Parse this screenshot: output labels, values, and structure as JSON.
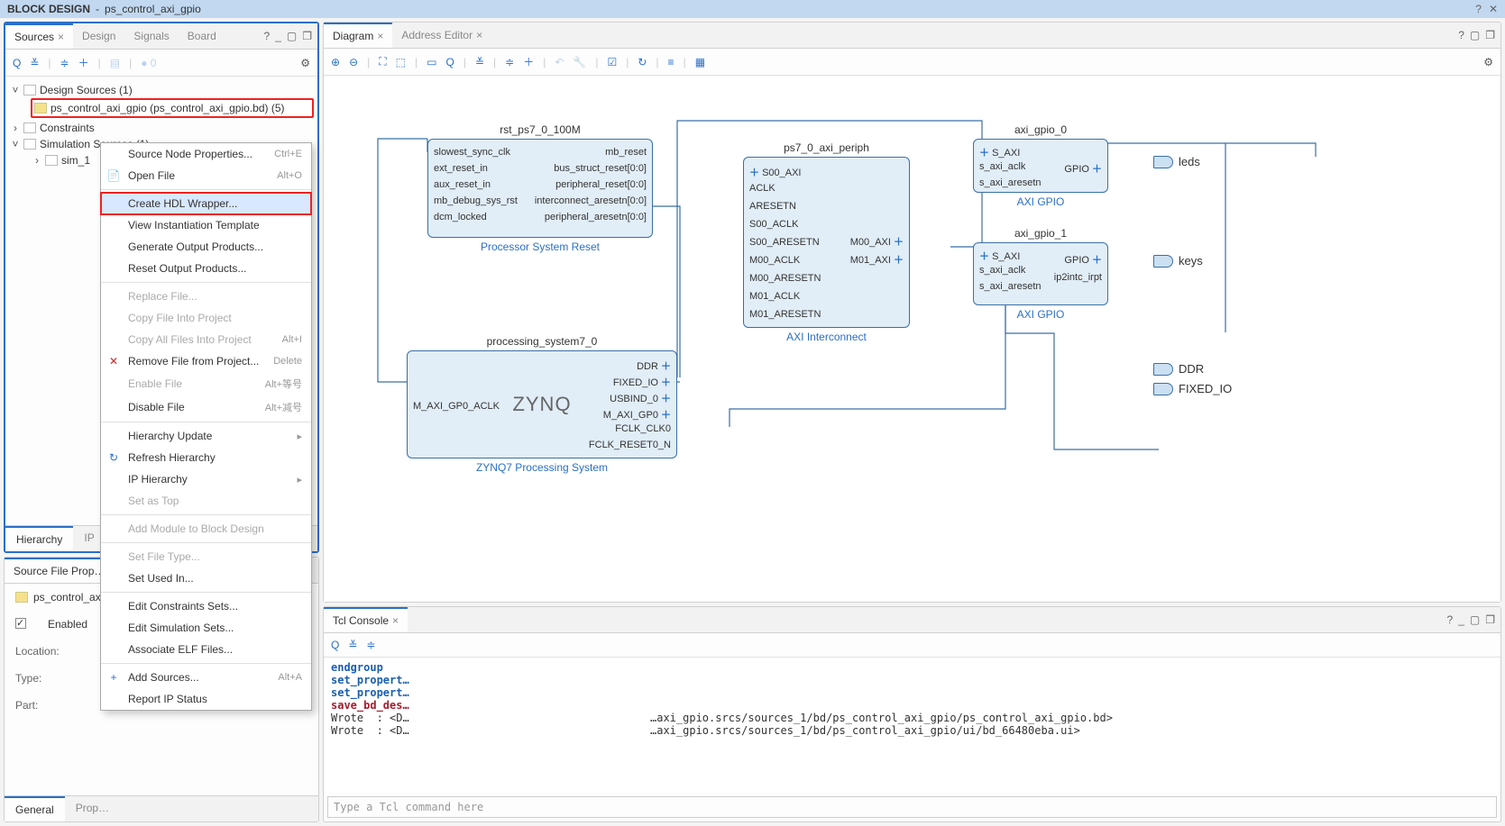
{
  "window": {
    "title_prefix": "BLOCK DESIGN",
    "title_name": "ps_control_axi_gpio"
  },
  "sources_panel": {
    "tabs": [
      "Sources",
      "Design",
      "Signals",
      "Board"
    ],
    "active_tab": 0,
    "tree": {
      "design_sources": "Design Sources (1)",
      "bd_item": "ps_control_axi_gpio (ps_control_axi_gpio.bd) (5)",
      "constraints": "Constraints",
      "simulation": "Simulation Sources (1)",
      "sim1": "sim_1"
    },
    "footer_tabs": [
      "Hierarchy",
      "IP"
    ]
  },
  "props_panel": {
    "title": "Source File Prop…",
    "file": "ps_control_ax…",
    "rows": {
      "enabled": "Enabled",
      "location": "Location:",
      "type": "Type:",
      "part": "Part:"
    },
    "footer_tabs": [
      "General",
      "Prop…"
    ]
  },
  "context_menu": [
    {
      "label": "Source Node Properties...",
      "shortcut": "Ctrl+E",
      "icon": ""
    },
    {
      "label": "Open File",
      "shortcut": "Alt+O",
      "icon": "📄"
    },
    {
      "sep": true
    },
    {
      "label": "Create HDL Wrapper...",
      "highlight": true
    },
    {
      "label": "View Instantiation Template"
    },
    {
      "label": "Generate Output Products..."
    },
    {
      "label": "Reset Output Products..."
    },
    {
      "sep": true
    },
    {
      "label": "Replace File...",
      "disabled": true
    },
    {
      "label": "Copy File Into Project",
      "disabled": true
    },
    {
      "label": "Copy All Files Into Project",
      "shortcut": "Alt+I",
      "disabled": true
    },
    {
      "label": "Remove File from Project...",
      "shortcut": "Delete",
      "icon": "✕",
      "iconRed": true
    },
    {
      "label": "Enable File",
      "shortcut": "Alt+等号",
      "disabled": true
    },
    {
      "label": "Disable File",
      "shortcut": "Alt+减号"
    },
    {
      "sep": true
    },
    {
      "label": "Hierarchy Update",
      "submenu": true
    },
    {
      "label": "Refresh Hierarchy",
      "icon": "↻"
    },
    {
      "label": "IP Hierarchy",
      "submenu": true
    },
    {
      "label": "Set as Top",
      "disabled": true
    },
    {
      "sep": true
    },
    {
      "label": "Add Module to Block Design",
      "disabled": true
    },
    {
      "sep": true
    },
    {
      "label": "Set File Type...",
      "disabled": true
    },
    {
      "label": "Set Used In..."
    },
    {
      "sep": true
    },
    {
      "label": "Edit Constraints Sets..."
    },
    {
      "label": "Edit Simulation Sets..."
    },
    {
      "label": "Associate ELF Files..."
    },
    {
      "sep": true
    },
    {
      "label": "Add Sources...",
      "shortcut": "Alt+A",
      "icon": "+"
    },
    {
      "label": "Report IP Status"
    }
  ],
  "diagram": {
    "tabs": [
      "Diagram",
      "Address Editor"
    ],
    "blocks": {
      "rst": {
        "header": "rst_ps7_0_100M",
        "title": "Processor System Reset",
        "left": [
          "slowest_sync_clk",
          "ext_reset_in",
          "aux_reset_in",
          "mb_debug_sys_rst",
          "dcm_locked"
        ],
        "right": [
          "mb_reset",
          "bus_struct_reset[0:0]",
          "peripheral_reset[0:0]",
          "interconnect_aresetn[0:0]",
          "peripheral_aresetn[0:0]"
        ]
      },
      "zynq": {
        "header": "processing_system7_0",
        "title": "ZYNQ7 Processing System",
        "logo": "ZYNQ",
        "left": [
          "M_AXI_GP0_ACLK"
        ],
        "right": [
          "DDR",
          "FIXED_IO",
          "USBIND_0",
          "M_AXI_GP0",
          "FCLK_CLK0",
          "FCLK_RESET0_N"
        ]
      },
      "interconnect": {
        "header": "ps7_0_axi_periph",
        "title": "AXI Interconnect",
        "left": [
          "S00_AXI",
          "ACLK",
          "ARESETN",
          "S00_ACLK",
          "S00_ARESETN",
          "M00_ACLK",
          "M00_ARESETN",
          "M01_ACLK",
          "M01_ARESETN"
        ],
        "right": [
          "M00_AXI",
          "M01_AXI"
        ]
      },
      "gpio0": {
        "header": "axi_gpio_0",
        "title": "AXI GPIO",
        "left": [
          "S_AXI",
          "s_axi_aclk",
          "s_axi_aresetn"
        ],
        "right": [
          "GPIO"
        ]
      },
      "gpio1": {
        "header": "axi_gpio_1",
        "title": "AXI GPIO",
        "left": [
          "S_AXI",
          "s_axi_aclk",
          "s_axi_aresetn"
        ],
        "right": [
          "GPIO",
          "ip2intc_irpt"
        ]
      }
    },
    "ext_ports": [
      "leds",
      "keys",
      "DDR",
      "FIXED_IO"
    ]
  },
  "console": {
    "title": "Tcl Console",
    "lines": [
      {
        "cls": "kw1",
        "text": "endgroup"
      },
      {
        "cls": "kw1",
        "text": "set_propert…"
      },
      {
        "cls": "kw1",
        "text": "set_propert…"
      },
      {
        "cls": "kw2",
        "text": "save_bd_des…"
      },
      {
        "cls": "",
        "text": "Wrote  : <D…                                     …axi_gpio.srcs/sources_1/bd/ps_control_axi_gpio/ps_control_axi_gpio.bd>"
      },
      {
        "cls": "",
        "text": "Wrote  : <D…                                     …axi_gpio.srcs/sources_1/bd/ps_control_axi_gpio/ui/bd_66480eba.ui>"
      }
    ],
    "placeholder": "Type a Tcl command here"
  }
}
